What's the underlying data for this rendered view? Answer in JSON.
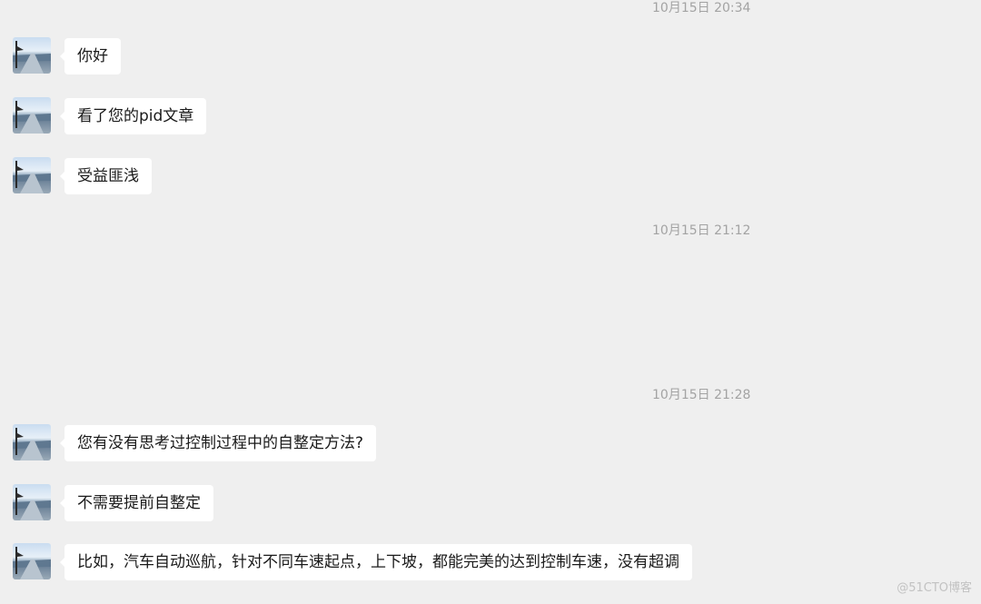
{
  "chat": {
    "timestamps": [
      "10月15日 20:34",
      "10月15日 21:12",
      "10月15日 21:28"
    ],
    "messages": [
      "你好",
      "看了您的pid文章",
      "受益匪浅",
      "您有没有思考过控制过程中的自整定方法?",
      "不需要提前自整定",
      "比如，汽车自动巡航，针对不同车速起点，上下坡，都能完美的达到控制车速，没有超调"
    ],
    "avatar_icon": "sender-avatar-photo-icon",
    "bubble_color": "#ffffff",
    "background_color": "#efefef",
    "timestamp_color": "#a3a3a3"
  },
  "watermark": {
    "text": "@51CTO博客"
  }
}
